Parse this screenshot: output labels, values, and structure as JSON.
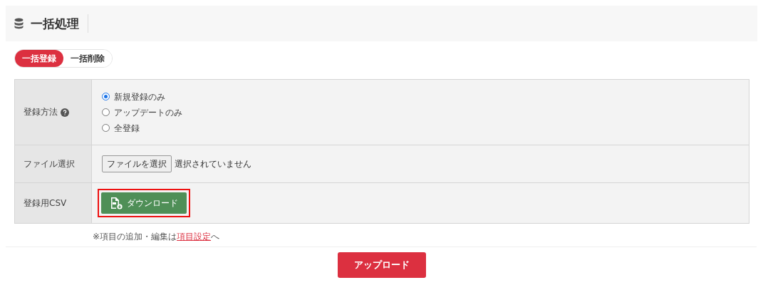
{
  "header": {
    "title": "一括処理"
  },
  "tabs": [
    {
      "label": "一括登録",
      "selected": true
    },
    {
      "label": "一括削除",
      "selected": false
    }
  ],
  "form": {
    "rows": [
      {
        "kind": "radio",
        "label": "登録方法",
        "help": true,
        "options": [
          {
            "label": "新規登録のみ",
            "selected": true
          },
          {
            "label": "アップデートのみ",
            "selected": false
          },
          {
            "label": "全登録",
            "selected": false
          }
        ]
      },
      {
        "kind": "file",
        "label": "ファイル選択",
        "button": "ファイルを選択",
        "status": "選択されていません"
      },
      {
        "kind": "download",
        "label": "登録用CSV",
        "button": "ダウンロード",
        "highlighted": true
      }
    ]
  },
  "note": {
    "before": "※項目の追加・編集は",
    "link": "項目設定",
    "after": "へ"
  },
  "submit": "アップロード"
}
